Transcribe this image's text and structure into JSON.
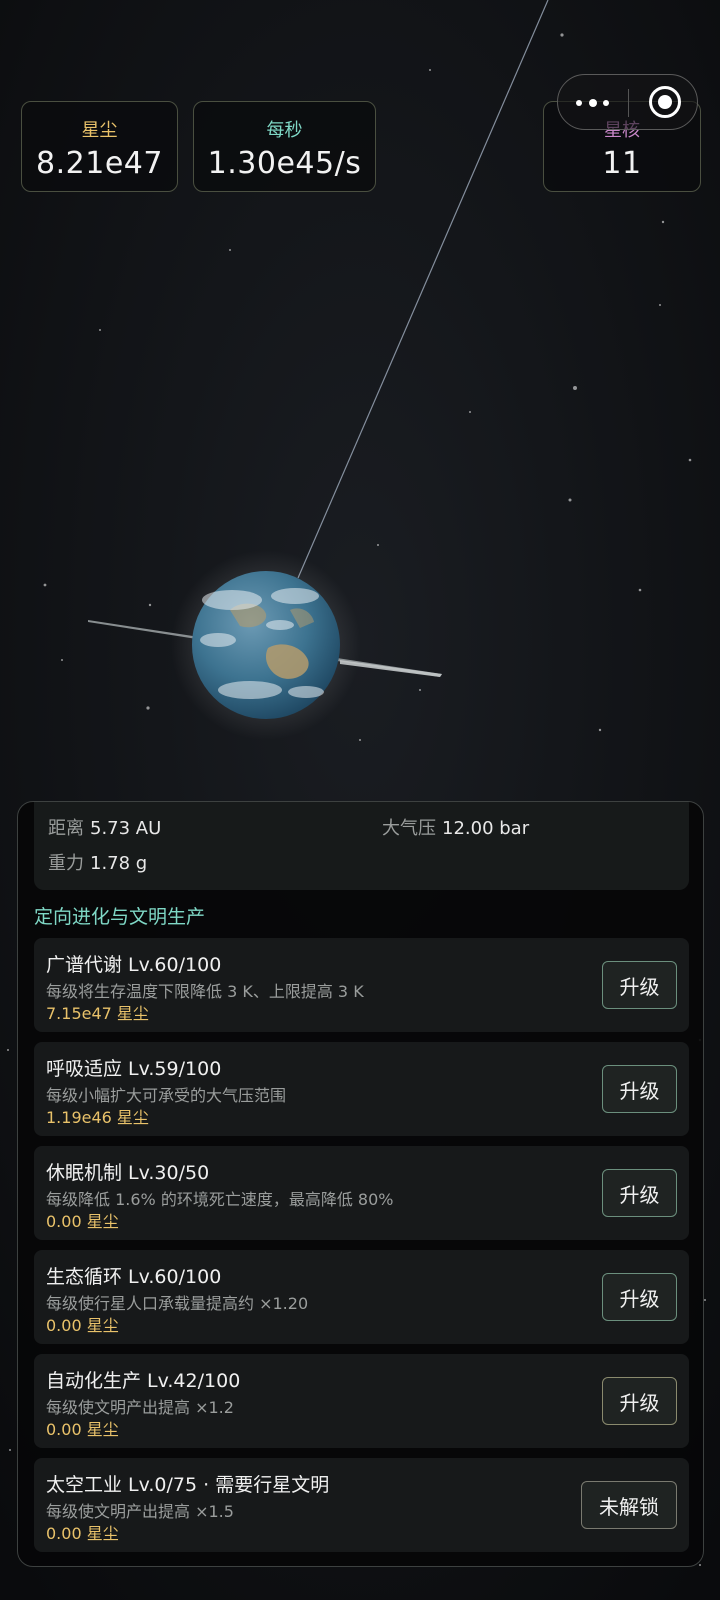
{
  "header": {
    "stardust": {
      "label": "星尘",
      "value": "8.21e47",
      "label_color": "#e9c26a"
    },
    "per_second": {
      "label": "每秒",
      "value": "1.30e45/s",
      "label_color": "#7fd8c6"
    },
    "star_core": {
      "label": "星核",
      "value": "11",
      "label_color": "#c987c9"
    }
  },
  "capsule": {
    "more_icon": "more-dots-icon",
    "close_icon": "target-icon"
  },
  "planet": {
    "distance_label": "距离",
    "distance_value": "5.73 AU",
    "pressure_label": "大气压",
    "pressure_value": "12.00 bar",
    "gravity_label": "重力",
    "gravity_value": "1.78 g"
  },
  "section_title": "定向进化与文明生产",
  "upgrades": [
    {
      "name": "广谱代谢 Lv.60/100",
      "desc": "每级将生存温度下限降低 3 K、上限提高 3 K",
      "cost": "7.15e47 星尘",
      "button": "升级"
    },
    {
      "name": "呼吸适应 Lv.59/100",
      "desc": "每级小幅扩大可承受的大气压范围",
      "cost": "1.19e46 星尘",
      "button": "升级"
    },
    {
      "name": "休眠机制 Lv.30/50",
      "desc": "每级降低 1.6% 的环境死亡速度，最高降低 80%",
      "cost": "0.00 星尘",
      "button": "升级"
    },
    {
      "name": "生态循环 Lv.60/100",
      "desc": "每级使行星人口承载量提高约 ×1.20",
      "cost": "0.00 星尘",
      "button": "升级"
    },
    {
      "name": "自动化生产 Lv.42/100",
      "desc": "每级使文明产出提高 ×1.2",
      "cost": "0.00 星尘",
      "button": "升级"
    },
    {
      "name": "太空工业 Lv.0/75 · 需要行星文明",
      "desc": "每级使文明产出提高 ×1.5",
      "cost": "0.00 星尘",
      "button": "未解锁"
    }
  ]
}
